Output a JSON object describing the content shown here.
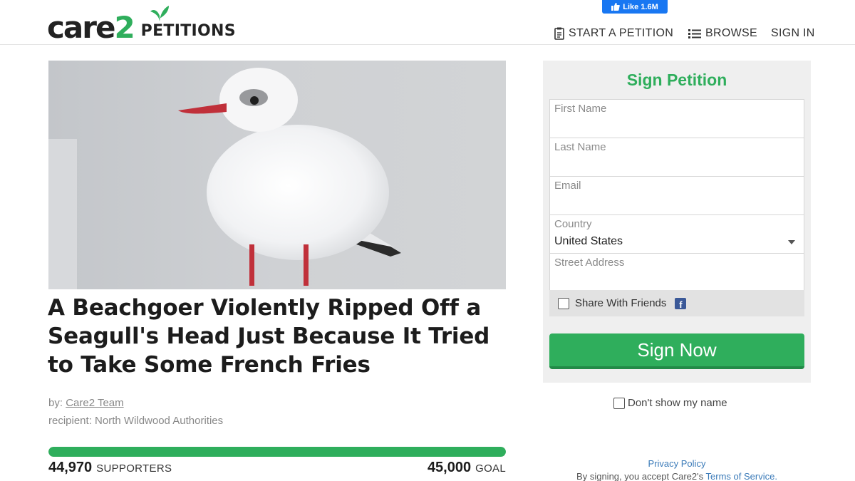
{
  "header": {
    "logo_main": "care",
    "logo_two": "2",
    "logo_petitions": "PETITIONS",
    "fb_like": "Like 1.6M",
    "nav": {
      "start": "START A PETITION",
      "browse": "BROWSE",
      "signin": "SIGN IN"
    }
  },
  "petition": {
    "title": "A Beachgoer Violently Ripped Off a Seagull's Head Just Because It Tried to Take Some French Fries",
    "by_prefix": "by: ",
    "author": "Care2 Team",
    "recipient": "recipient: North Wildwood Authorities",
    "supporters_count": "44,970",
    "supporters_label": "SUPPORTERS",
    "goal_count": "45,000",
    "goal_label": "GOAL",
    "progress_fraction": 0.9993
  },
  "form": {
    "title": "Sign Petition",
    "first_name_label": "First Name",
    "last_name_label": "Last Name",
    "email_label": "Email",
    "country_label": "Country",
    "country_value": "United States",
    "street_label": "Street Address",
    "share_label": "Share With Friends",
    "sign_button": "Sign Now",
    "dont_show": "Don't show my name",
    "privacy": "Privacy Policy",
    "terms_prefix": "By signing, you accept Care2's ",
    "terms_link": "Terms of Service."
  },
  "colors": {
    "brand_green": "#2fae5c",
    "facebook_blue": "#1877f2"
  },
  "icons": [
    "leaf-icon",
    "thumbs-up-icon",
    "clipboard-icon",
    "list-icon",
    "facebook-icon",
    "caret-down-icon"
  ]
}
